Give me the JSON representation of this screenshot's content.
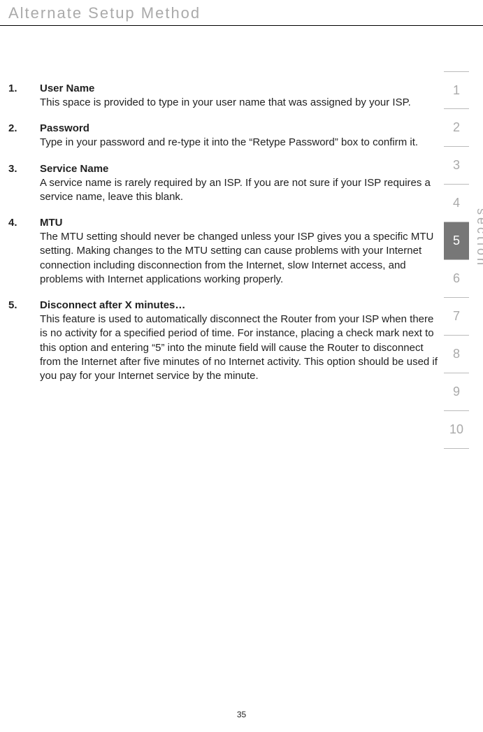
{
  "header": {
    "title": "Alternate Setup Method"
  },
  "items": [
    {
      "num": "1.",
      "title": "User Name",
      "text": "This space is provided to type in your user name that was assigned by your ISP."
    },
    {
      "num": "2.",
      "title": "Password",
      "text": "Type in your password and re-type it into the “Retype Password” box to confirm it."
    },
    {
      "num": "3.",
      "title": "Service Name",
      "text": "A service name is rarely required by an ISP. If you are not sure if your ISP requires a service name, leave this blank."
    },
    {
      "num": "4.",
      "title": "MTU",
      "text": "The MTU setting should never be changed unless your ISP gives you a specific MTU setting. Making changes to the MTU setting can cause problems with your Internet connection including disconnection from the Internet, slow Internet access, and problems with Internet applications working properly."
    },
    {
      "num": "5.",
      "title": "Disconnect after X minutes…",
      "text": "This feature is used to automatically disconnect the Router from your ISP when there is no activity for a specified period of time. For instance, placing a check mark next to this option and entering “5” into the minute field will cause the Router to disconnect from the Internet after five minutes of no Internet activity. This option should be used if you pay for your Internet service by the minute."
    }
  ],
  "tabs": [
    "1",
    "2",
    "3",
    "4",
    "5",
    "6",
    "7",
    "8",
    "9",
    "10"
  ],
  "activeTab": 4,
  "sideLabel": "section",
  "pageNumber": "35"
}
